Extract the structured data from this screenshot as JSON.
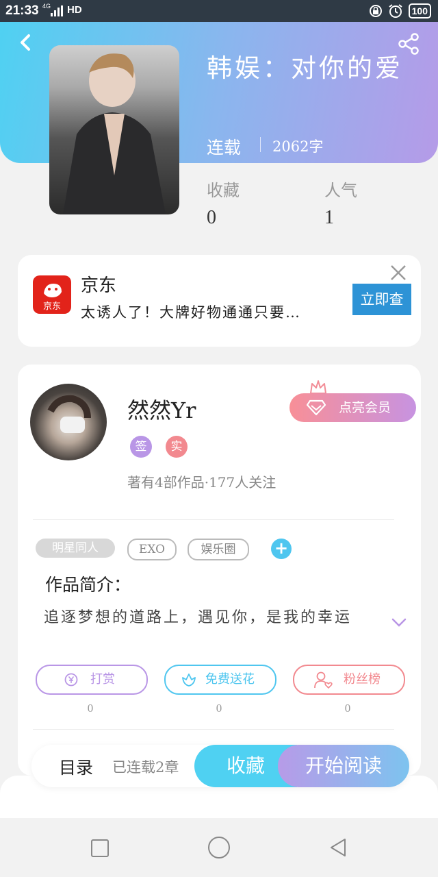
{
  "status_bar": {
    "time": "21:33",
    "network": "4G",
    "hd": "HD",
    "battery": "100"
  },
  "book": {
    "title": "韩娱：对你的爱",
    "status": "连载",
    "words": "2062字"
  },
  "stats": [
    {
      "label": "收藏",
      "value": "0"
    },
    {
      "label": "人气",
      "value": "1"
    }
  ],
  "ad": {
    "logo_text": "京东",
    "brand": "京东",
    "desc": "太诱人了！大牌好物通通只要…",
    "button": "立即查"
  },
  "author": {
    "name": "然然Yr",
    "badges": [
      {
        "text": "签",
        "color": "#b996e6"
      },
      {
        "text": "实",
        "color": "#f2898f"
      }
    ],
    "meta": "著有4部作品·177人关注",
    "member_button": "点亮会员"
  },
  "tags": [
    "明星同人",
    "EXO",
    "娱乐圈"
  ],
  "intro": {
    "title": "作品简介：",
    "text": "追逐梦想的道路上，遇见你，是我的幸运"
  },
  "actions": [
    {
      "label": "打赏",
      "count": "0",
      "color": "#b996e6"
    },
    {
      "label": "免费送花",
      "count": "0",
      "color": "#4fc6ef"
    },
    {
      "label": "粉丝榜",
      "count": "0",
      "color": "#f2898f"
    }
  ],
  "bottom": {
    "toc": "目录",
    "chapters": "已连载2章",
    "fav": "收藏",
    "read": "开始阅读"
  }
}
